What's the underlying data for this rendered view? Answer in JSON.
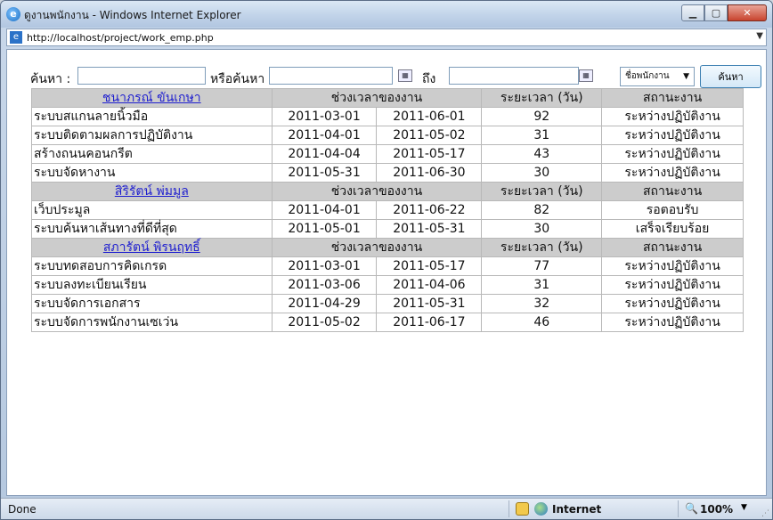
{
  "window": {
    "title": "ดูงานพนักงาน - Windows Internet Explorer",
    "icon": "ie-icon",
    "address": "http://localhost/project/work_emp.php"
  },
  "search": {
    "label": "ค้นหา :",
    "or_label": "หรือค้นหา",
    "to_label": "ถึง",
    "text_value": "",
    "date_from_value": "",
    "date_to_value": "",
    "select_value": "ชื่อพนักงาน",
    "button_label": "ค้นหา"
  },
  "table": {
    "headers": {
      "period": "ช่วงเวลาของงาน",
      "duration": "ระยะเวลา (วัน)",
      "status": "สถานะงาน"
    },
    "groups": [
      {
        "employee": "ชนาภรณ์ ขันเกษา",
        "rows": [
          {
            "task": "ระบบสแกนลายนิ้วมือ",
            "start": "2011-03-01",
            "end": "2011-06-01",
            "days": "92",
            "status": "ระหว่างปฏิบัติงาน"
          },
          {
            "task": "ระบบติดตามผลการปฏิบัติงาน",
            "start": "2011-04-01",
            "end": "2011-05-02",
            "days": "31",
            "status": "ระหว่างปฏิบัติงาน"
          },
          {
            "task": "สร้างถนนคอนกรีต",
            "start": "2011-04-04",
            "end": "2011-05-17",
            "days": "43",
            "status": "ระหว่างปฏิบัติงาน"
          },
          {
            "task": "ระบบจัดหางาน",
            "start": "2011-05-31",
            "end": "2011-06-30",
            "days": "30",
            "status": "ระหว่างปฏิบัติงาน"
          }
        ]
      },
      {
        "employee": "สิริรัตน์ พ่มมูล",
        "rows": [
          {
            "task": "เว็บประมูล",
            "start": "2011-04-01",
            "end": "2011-06-22",
            "days": "82",
            "status": "รอตอบรับ"
          },
          {
            "task": "ระบบค้นหาเส้นทางที่ดีที่สุด",
            "start": "2011-05-01",
            "end": "2011-05-31",
            "days": "30",
            "status": "เสร็จเรียบร้อย"
          }
        ]
      },
      {
        "employee": "สภารัตน์ พิรนฤทธิ์",
        "rows": [
          {
            "task": "ระบบทดสอบการคิดเกรด",
            "start": "2011-03-01",
            "end": "2011-05-17",
            "days": "77",
            "status": "ระหว่างปฏิบัติงาน"
          },
          {
            "task": "ระบบลงทะเบียนเรียน",
            "start": "2011-03-06",
            "end": "2011-04-06",
            "days": "31",
            "status": "ระหว่างปฏิบัติงาน"
          },
          {
            "task": "ระบบจัดการเอกสาร",
            "start": "2011-04-29",
            "end": "2011-05-31",
            "days": "32",
            "status": "ระหว่างปฏิบัติงาน"
          },
          {
            "task": "ระบบจัดการพนักงานเซเว่น",
            "start": "2011-05-02",
            "end": "2011-06-17",
            "days": "46",
            "status": "ระหว่างปฏิบัติงาน"
          }
        ]
      }
    ]
  },
  "statusbar": {
    "left": "Done",
    "zone": "Internet",
    "zoom": "100%"
  }
}
